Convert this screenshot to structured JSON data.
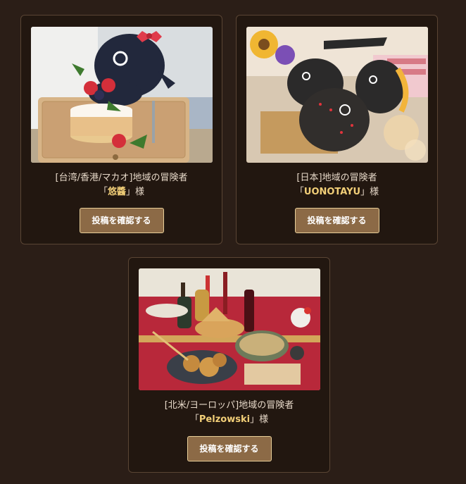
{
  "colors": {
    "page_background": "#2b1e17",
    "card_background": "#221710",
    "card_border": "#5a4534",
    "name_highlight": "#f2cf78",
    "button_background": "#8c6a46",
    "button_border": "#e8cf99"
  },
  "cards": [
    {
      "region": "[台湾/香港/マカオ]地域の冒険者",
      "quote_open": "「",
      "name": "悠醬",
      "quote_close": "」",
      "suffix": "様",
      "button_label": "投稿を確認する"
    },
    {
      "region": "[日本]地域の冒険者",
      "quote_open": "「",
      "name": "UONOTAYU",
      "quote_close": "」",
      "suffix": "様",
      "button_label": "投稿を確認する"
    },
    {
      "region": "[北米/ヨーロッパ]地域の冒険者",
      "quote_open": "「",
      "name": "Pelzowski",
      "quote_close": "」",
      "suffix": "様",
      "button_label": "投稿を確認する"
    }
  ]
}
